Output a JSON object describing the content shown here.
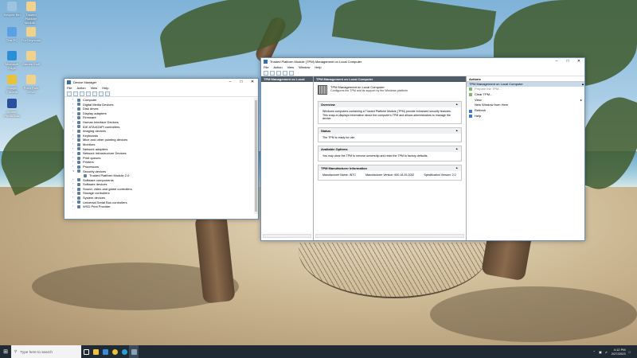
{
  "desktop": {
    "icons": [
      {
        "label": "Recycle Bin",
        "color": "#9cc3e0"
      },
      {
        "label": "Trusted Platform Module...",
        "color": "#f0d28c"
      },
      {
        "label": "This PC",
        "color": "#5aa0e6"
      },
      {
        "label": "For Reynolds",
        "color": "#f0d28c"
      },
      {
        "label": "Microsoft Edge",
        "color": "#2a8fd6"
      },
      {
        "label": "Games Stuff",
        "color": "#f0d28c"
      },
      {
        "label": "Google Chrome",
        "color": "#e8c23a"
      },
      {
        "label": "Point Park Drive",
        "color": "#f0d28c"
      },
      {
        "label": "Brother iPrint&Scan",
        "color": "#2a4f9c"
      }
    ]
  },
  "device_manager": {
    "title": "Device Manager",
    "menu": [
      "File",
      "Action",
      "View",
      "Help"
    ],
    "tree": [
      {
        "label": "Computer",
        "expanded": false
      },
      {
        "label": "Digital Media Devices",
        "expanded": false
      },
      {
        "label": "Disk drives",
        "expanded": false
      },
      {
        "label": "Display adapters",
        "expanded": false
      },
      {
        "label": "Firmware",
        "expanded": false
      },
      {
        "label": "Human Interface Devices",
        "expanded": false
      },
      {
        "label": "IDE ATA/ATAPI controllers",
        "expanded": false
      },
      {
        "label": "Imaging devices",
        "expanded": false
      },
      {
        "label": "Keyboards",
        "expanded": false
      },
      {
        "label": "Mice and other pointing devices",
        "expanded": false
      },
      {
        "label": "Monitors",
        "expanded": false
      },
      {
        "label": "Network adapters",
        "expanded": false
      },
      {
        "label": "Network Infrastructure Devices",
        "expanded": false
      },
      {
        "label": "Print queues",
        "expanded": false
      },
      {
        "label": "Printers",
        "expanded": false
      },
      {
        "label": "Processors",
        "expanded": false
      },
      {
        "label": "Security devices",
        "expanded": true
      },
      {
        "label": "Trusted Platform Module 2.0",
        "child": true
      },
      {
        "label": "Software components",
        "expanded": false
      },
      {
        "label": "Software devices",
        "expanded": false
      },
      {
        "label": "Sound, video and game controllers",
        "expanded": false
      },
      {
        "label": "Storage controllers",
        "expanded": false
      },
      {
        "label": "System devices",
        "expanded": false
      },
      {
        "label": "Universal Serial Bus controllers",
        "expanded": false
      },
      {
        "label": "WSD Print Provider",
        "expanded": false
      }
    ]
  },
  "tpm": {
    "title": "Trusted Platform Module (TPM) Management on Local Computer",
    "menu": [
      "File",
      "Action",
      "View",
      "Window",
      "Help"
    ],
    "left_header": "TPM Management on Local Comp",
    "center_header": "TPM Management on Local Computer",
    "banner_title": "TPM Management on Local Computer",
    "banner_sub": "Configures the TPM and its support by the Windows platform",
    "overview": {
      "title": "Overview",
      "text": "Windows computers containing a Trusted Platform Module (TPM) provide enhanced security features. This snap-in displays information about the computer's TPM and allows administrators to manage the device."
    },
    "status": {
      "title": "Status",
      "text": "The TPM is ready for use."
    },
    "options": {
      "title": "Available Options",
      "text": "You may clear the TPM to remove ownership and reset the TPM to factory defaults."
    },
    "manufacturer": {
      "title": "TPM Manufacturer Information",
      "name_label": "Manufacturer Name:",
      "name_value": "INTC",
      "version_label": "Manufacturer Version:",
      "version_value": "600.18.25.2032",
      "spec_label": "Specification Version:",
      "spec_value": "2.0"
    },
    "actions": {
      "header": "Actions",
      "selected": "TPM Management on Local Computer",
      "items": [
        {
          "label": "Prepare the TPM...",
          "disabled": true,
          "icon_color": "#7db86a"
        },
        {
          "label": "Clear TPM...",
          "disabled": false,
          "icon_color": "#7db86a"
        },
        {
          "label": "View",
          "disabled": false,
          "submenu": true,
          "icon_color": ""
        },
        {
          "label": "New Window from Here",
          "disabled": false,
          "icon_color": ""
        },
        {
          "label": "Refresh",
          "disabled": false,
          "icon_color": "#3a7bd5"
        },
        {
          "label": "Help",
          "disabled": false,
          "icon_color": "#3a7bd5"
        }
      ]
    }
  },
  "taskbar": {
    "search_placeholder": "Type here to search",
    "time": "4:12 PM",
    "date": "2/27/2023"
  }
}
